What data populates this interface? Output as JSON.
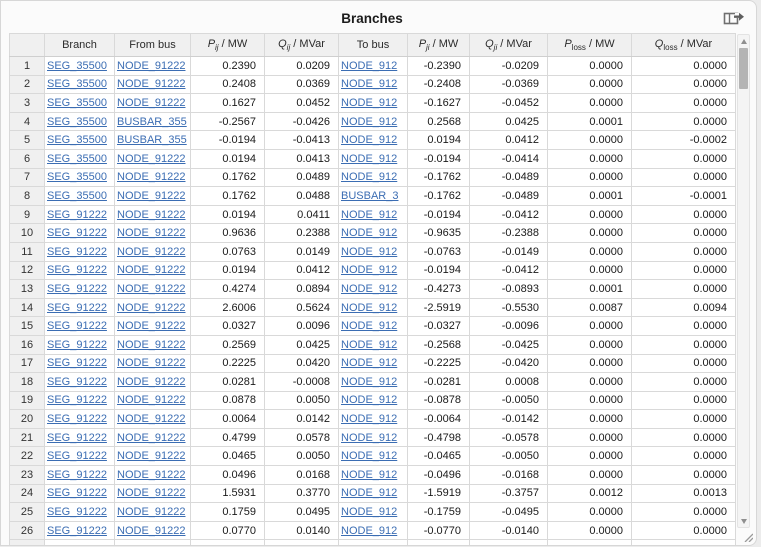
{
  "title": "Branches",
  "colors": {
    "link": "#3b6db3",
    "header_bg": "#f0f0f0",
    "grid": "#d9d9d9",
    "panel_bg": "#fbfbfb"
  },
  "toolbar": {
    "export_icon": "export-table-icon"
  },
  "scrollbar": {
    "up_icon": "scroll-up-arrow",
    "down_icon": "scroll-down-arrow",
    "grip_icon": "resize-grip-icon"
  },
  "table": {
    "columns": [
      {
        "label": ""
      },
      {
        "label": "Branch"
      },
      {
        "label": "From bus"
      },
      {
        "var": "P",
        "sub": "ij",
        "unit": " / MW",
        "italic_sub": true
      },
      {
        "var": "Q",
        "sub": "ij",
        "unit": " / MVar",
        "italic_sub": true
      },
      {
        "label": "To bus"
      },
      {
        "var": "P",
        "sub": "ji",
        "unit": " / MW",
        "italic_sub": true
      },
      {
        "var": "Q",
        "sub": "ji",
        "unit": " / MVar",
        "italic_sub": true
      },
      {
        "var": "P",
        "sub": "loss",
        "unit": " / MW",
        "italic_sub": false
      },
      {
        "var": "Q",
        "sub": "loss",
        "unit": " / MVar",
        "italic_sub": false
      }
    ],
    "rows": [
      {
        "idx": "1",
        "branch": "SEG_35500",
        "from_bus": "NODE_91222",
        "pij": "0.2390",
        "qij": "0.0209",
        "to_bus": "NODE_912",
        "pji": "-0.2390",
        "qji": "-0.0209",
        "ploss": "0.0000",
        "qloss": "0.0000"
      },
      {
        "idx": "2",
        "branch": "SEG_35500",
        "from_bus": "NODE_91222",
        "pij": "0.2408",
        "qij": "0.0369",
        "to_bus": "NODE_912",
        "pji": "-0.2408",
        "qji": "-0.0369",
        "ploss": "0.0000",
        "qloss": "0.0000"
      },
      {
        "idx": "3",
        "branch": "SEG_35500",
        "from_bus": "NODE_91222",
        "pij": "0.1627",
        "qij": "0.0452",
        "to_bus": "NODE_912",
        "pji": "-0.1627",
        "qji": "-0.0452",
        "ploss": "0.0000",
        "qloss": "0.0000"
      },
      {
        "idx": "4",
        "branch": "SEG_35500",
        "from_bus": "BUSBAR_355",
        "pij": "-0.2567",
        "qij": "-0.0426",
        "to_bus": "NODE_912",
        "pji": "0.2568",
        "qji": "0.0425",
        "ploss": "0.0001",
        "qloss": "0.0000"
      },
      {
        "idx": "5",
        "branch": "SEG_35500",
        "from_bus": "BUSBAR_355",
        "pij": "-0.0194",
        "qij": "-0.0413",
        "to_bus": "NODE_912",
        "pji": "0.0194",
        "qji": "0.0412",
        "ploss": "0.0000",
        "qloss": "-0.0002"
      },
      {
        "idx": "6",
        "branch": "SEG_35500",
        "from_bus": "NODE_91222",
        "pij": "0.0194",
        "qij": "0.0413",
        "to_bus": "NODE_912",
        "pji": "-0.0194",
        "qji": "-0.0414",
        "ploss": "0.0000",
        "qloss": "0.0000"
      },
      {
        "idx": "7",
        "branch": "SEG_35500",
        "from_bus": "NODE_91222",
        "pij": "0.1762",
        "qij": "0.0489",
        "to_bus": "NODE_912",
        "pji": "-0.1762",
        "qji": "-0.0489",
        "ploss": "0.0000",
        "qloss": "0.0000"
      },
      {
        "idx": "8",
        "branch": "SEG_35500",
        "from_bus": "NODE_91222",
        "pij": "0.1762",
        "qij": "0.0488",
        "to_bus": "BUSBAR_3",
        "pji": "-0.1762",
        "qji": "-0.0489",
        "ploss": "0.0001",
        "qloss": "-0.0001"
      },
      {
        "idx": "9",
        "branch": "SEG_91222",
        "from_bus": "NODE_91222",
        "pij": "0.0194",
        "qij": "0.0411",
        "to_bus": "NODE_912",
        "pji": "-0.0194",
        "qji": "-0.0412",
        "ploss": "0.0000",
        "qloss": "0.0000"
      },
      {
        "idx": "10",
        "branch": "SEG_91222",
        "from_bus": "NODE_91222",
        "pij": "0.9636",
        "qij": "0.2388",
        "to_bus": "NODE_912",
        "pji": "-0.9635",
        "qji": "-0.2388",
        "ploss": "0.0000",
        "qloss": "0.0000"
      },
      {
        "idx": "11",
        "branch": "SEG_91222",
        "from_bus": "NODE_91222",
        "pij": "0.0763",
        "qij": "0.0149",
        "to_bus": "NODE_912",
        "pji": "-0.0763",
        "qji": "-0.0149",
        "ploss": "0.0000",
        "qloss": "0.0000"
      },
      {
        "idx": "12",
        "branch": "SEG_91222",
        "from_bus": "NODE_91222",
        "pij": "0.0194",
        "qij": "0.0412",
        "to_bus": "NODE_912",
        "pji": "-0.0194",
        "qji": "-0.0412",
        "ploss": "0.0000",
        "qloss": "0.0000"
      },
      {
        "idx": "13",
        "branch": "SEG_91222",
        "from_bus": "NODE_91222",
        "pij": "0.4274",
        "qij": "0.0894",
        "to_bus": "NODE_912",
        "pji": "-0.4273",
        "qji": "-0.0893",
        "ploss": "0.0001",
        "qloss": "0.0000"
      },
      {
        "idx": "14",
        "branch": "SEG_91222",
        "from_bus": "NODE_91222",
        "pij": "2.6006",
        "qij": "0.5624",
        "to_bus": "NODE_912",
        "pji": "-2.5919",
        "qji": "-0.5530",
        "ploss": "0.0087",
        "qloss": "0.0094"
      },
      {
        "idx": "15",
        "branch": "SEG_91222",
        "from_bus": "NODE_91222",
        "pij": "0.0327",
        "qij": "0.0096",
        "to_bus": "NODE_912",
        "pji": "-0.0327",
        "qji": "-0.0096",
        "ploss": "0.0000",
        "qloss": "0.0000"
      },
      {
        "idx": "16",
        "branch": "SEG_91222",
        "from_bus": "NODE_91222",
        "pij": "0.2569",
        "qij": "0.0425",
        "to_bus": "NODE_912",
        "pji": "-0.2568",
        "qji": "-0.0425",
        "ploss": "0.0000",
        "qloss": "0.0000"
      },
      {
        "idx": "17",
        "branch": "SEG_91222",
        "from_bus": "NODE_91222",
        "pij": "0.2225",
        "qij": "0.0420",
        "to_bus": "NODE_912",
        "pji": "-0.2225",
        "qji": "-0.0420",
        "ploss": "0.0000",
        "qloss": "0.0000"
      },
      {
        "idx": "18",
        "branch": "SEG_91222",
        "from_bus": "NODE_91222",
        "pij": "0.0281",
        "qij": "-0.0008",
        "to_bus": "NODE_912",
        "pji": "-0.0281",
        "qji": "0.0008",
        "ploss": "0.0000",
        "qloss": "0.0000"
      },
      {
        "idx": "19",
        "branch": "SEG_91222",
        "from_bus": "NODE_91222",
        "pij": "0.0878",
        "qij": "0.0050",
        "to_bus": "NODE_912",
        "pji": "-0.0878",
        "qji": "-0.0050",
        "ploss": "0.0000",
        "qloss": "0.0000"
      },
      {
        "idx": "20",
        "branch": "SEG_91222",
        "from_bus": "NODE_91222",
        "pij": "0.0064",
        "qij": "0.0142",
        "to_bus": "NODE_912",
        "pji": "-0.0064",
        "qji": "-0.0142",
        "ploss": "0.0000",
        "qloss": "0.0000"
      },
      {
        "idx": "21",
        "branch": "SEG_91222",
        "from_bus": "NODE_91222",
        "pij": "0.4799",
        "qij": "0.0578",
        "to_bus": "NODE_912",
        "pji": "-0.4798",
        "qji": "-0.0578",
        "ploss": "0.0000",
        "qloss": "0.0000"
      },
      {
        "idx": "22",
        "branch": "SEG_91222",
        "from_bus": "NODE_91222",
        "pij": "0.0465",
        "qij": "0.0050",
        "to_bus": "NODE_912",
        "pji": "-0.0465",
        "qji": "-0.0050",
        "ploss": "0.0000",
        "qloss": "0.0000"
      },
      {
        "idx": "23",
        "branch": "SEG_91222",
        "from_bus": "NODE_91222",
        "pij": "0.0496",
        "qij": "0.0168",
        "to_bus": "NODE_912",
        "pji": "-0.0496",
        "qji": "-0.0168",
        "ploss": "0.0000",
        "qloss": "0.0000"
      },
      {
        "idx": "24",
        "branch": "SEG_91222",
        "from_bus": "NODE_91222",
        "pij": "1.5931",
        "qij": "0.3770",
        "to_bus": "NODE_912",
        "pji": "-1.5919",
        "qji": "-0.3757",
        "ploss": "0.0012",
        "qloss": "0.0013"
      },
      {
        "idx": "25",
        "branch": "SEG_91222",
        "from_bus": "NODE_91222",
        "pij": "0.1759",
        "qij": "0.0495",
        "to_bus": "NODE_912",
        "pji": "-0.1759",
        "qji": "-0.0495",
        "ploss": "0.0000",
        "qloss": "0.0000"
      },
      {
        "idx": "26",
        "branch": "SEG_91222",
        "from_bus": "NODE_91222",
        "pij": "0.0770",
        "qij": "0.0140",
        "to_bus": "NODE_912",
        "pji": "-0.0770",
        "qji": "-0.0140",
        "ploss": "0.0000",
        "qloss": "0.0000"
      }
    ]
  }
}
